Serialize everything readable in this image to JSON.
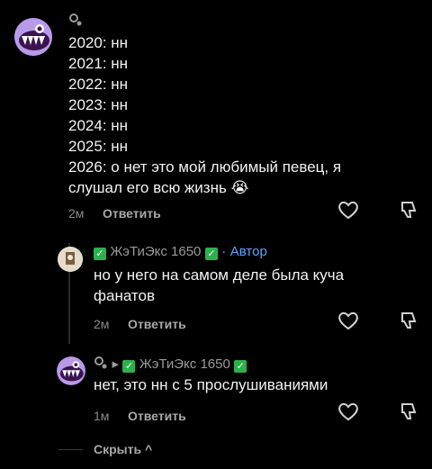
{
  "comment": {
    "lines": [
      "2020: нн",
      "2021: нн",
      "2022: нн",
      "2023: нн",
      "2024: нн",
      "2025: нн",
      "2026: о нет это мой любимый певец, я",
      "слушал его всю жизнь"
    ],
    "emoji": "😭",
    "time": "2м",
    "reply_label": "Ответить"
  },
  "reply1": {
    "username": "ЖэТиЭкс 1650",
    "check": "✓",
    "dot": "·",
    "author_label": "Автор",
    "lines": [
      "но у него на самом деле была куча",
      "фанатов"
    ],
    "time": "2м",
    "reply_label": "Ответить"
  },
  "reply2": {
    "arrow": "▸",
    "username": "ЖэТиЭкс 1650",
    "check": "✓",
    "text": "нет, это нн с 5 прослушиваниями",
    "time": "1м",
    "reply_label": "Ответить"
  },
  "hide": {
    "label": "Скрыть",
    "chevron": "^"
  }
}
